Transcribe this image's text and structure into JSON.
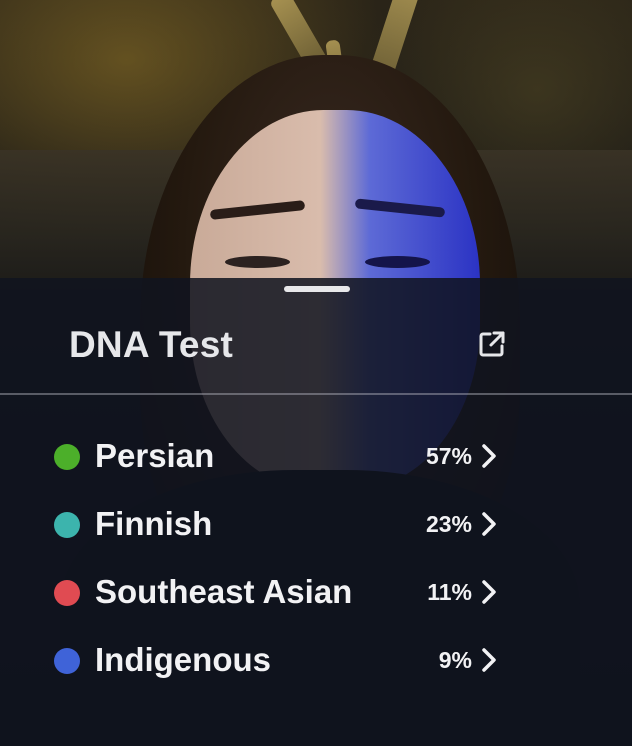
{
  "sheet": {
    "title": "DNA Test",
    "share_icon": "external-share-icon",
    "results": [
      {
        "label": "Persian",
        "percent": "57%",
        "value": 57,
        "color": "#4caf2a"
      },
      {
        "label": "Finnish",
        "percent": "23%",
        "value": 23,
        "color": "#3cb4ad"
      },
      {
        "label": "Southeast Asian",
        "percent": "11%",
        "value": 11,
        "color": "#e04b52"
      },
      {
        "label": "Indigenous",
        "percent": "9%",
        "value": 9,
        "color": "#3f63d8"
      }
    ]
  },
  "colors": {
    "sheet_background": "#101420",
    "text": "#f2f2f4"
  }
}
